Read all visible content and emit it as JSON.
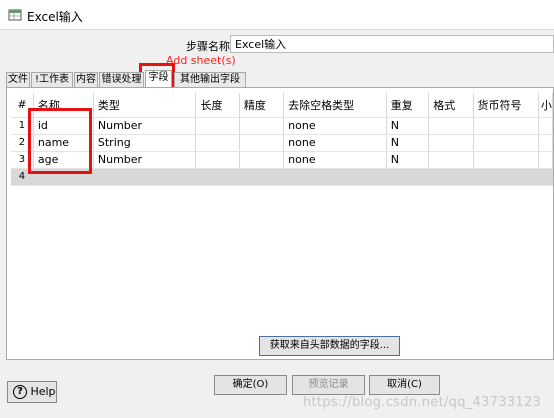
{
  "window": {
    "title": "Excel输入"
  },
  "step": {
    "label": "步骤名称",
    "value": "Excel输入"
  },
  "annotation": {
    "text": "Add sheet(s)"
  },
  "tabs": [
    {
      "label": "文件"
    },
    {
      "label": "!工作表"
    },
    {
      "label": "内容"
    },
    {
      "label": "错误处理"
    },
    {
      "label": "字段"
    },
    {
      "label": "其他输出字段"
    }
  ],
  "active_tab": "字段",
  "table": {
    "columns": [
      "#",
      "名称",
      "类型",
      "长度",
      "精度",
      "去除空格类型",
      "重复",
      "格式",
      "货币符号",
      "小"
    ],
    "rows": [
      {
        "num": "1",
        "name": "id",
        "type": "Number",
        "trim": "none",
        "repeat": "N"
      },
      {
        "num": "2",
        "name": "name",
        "type": "String",
        "trim": "none",
        "repeat": "N"
      },
      {
        "num": "3",
        "name": "age",
        "type": "Number",
        "trim": "none",
        "repeat": "N"
      },
      {
        "num": "4",
        "name": "",
        "type": "",
        "trim": "",
        "repeat": ""
      }
    ]
  },
  "buttons": {
    "get_fields": "获取来自头部数据的字段...",
    "ok": "确定(O)",
    "preview": "预览记录",
    "cancel": "取消(C)",
    "help": "Help"
  },
  "watermark": "https://blog.csdn.net/qq_43733123",
  "colors": {
    "annotation_red": "#e81010",
    "selected_row": "#d8d8d8"
  }
}
